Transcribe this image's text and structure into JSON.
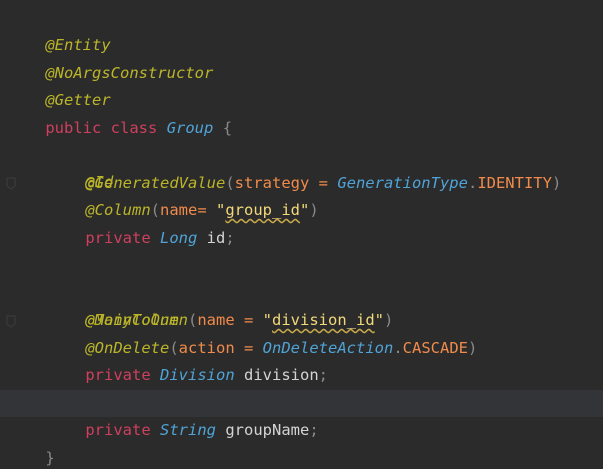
{
  "editor": {
    "language": "java",
    "theme": {
      "background": "#2b2b2b",
      "annotation": "#bbb529",
      "keyword": "#cf3f5e",
      "type": "#4fa3d6",
      "constant": "#f08b4b",
      "string": "#f2d97a",
      "current_line": "#333437"
    },
    "lines": [
      {
        "id": "l1",
        "text": "@Entity"
      },
      {
        "id": "l2",
        "text": "@NoArgsConstructor"
      },
      {
        "id": "l3",
        "text": "@Getter"
      },
      {
        "id": "l4",
        "text": "public class Group {"
      },
      {
        "id": "l5",
        "text": "@Id"
      },
      {
        "id": "l6",
        "text": "@GeneratedValue(strategy = GenerationType.IDENTITY)"
      },
      {
        "id": "l7",
        "text": "@Column(name= \"group_id\")"
      },
      {
        "id": "l8",
        "text": "private Long id;"
      },
      {
        "id": "l9",
        "text": ""
      },
      {
        "id": "l10",
        "text": "@ManyToOne"
      },
      {
        "id": "l11",
        "text": "@JoinColumn(name = \"division_id\")"
      },
      {
        "id": "l12",
        "text": "@OnDelete(action = OnDeleteAction.CASCADE)"
      },
      {
        "id": "l13",
        "text": "private Division division;"
      },
      {
        "id": "l14",
        "text": ""
      },
      {
        "id": "l15",
        "text": "private String groupName;"
      },
      {
        "id": "l16",
        "text": "}"
      }
    ]
  },
  "tokens": {
    "entity": "@Entity",
    "noargs": "@NoArgsConstructor",
    "getter": "@Getter",
    "public": "public",
    "class": "class",
    "group": "Group",
    "lbrace": " {",
    "id_ann": "@Id",
    "generated": "@GeneratedValue",
    "paren_open": "(",
    "strategy": "strategy = ",
    "generation_type": "GenerationType",
    "dot": ".",
    "identity": "IDENTITY",
    "paren_close": ")",
    "column": "@Column",
    "name_eq_a": "name= ",
    "quote": "\"",
    "group_id": "group_id",
    "private": "private",
    "long": "Long",
    "id_field": "id",
    "semicolon": ";",
    "many_to_one": "@ManyToOne",
    "join_column": "@JoinColumn",
    "name_eq_b": "name = ",
    "division_id": "division_id",
    "on_delete": "@OnDelete",
    "action": "action = ",
    "on_delete_action": "OnDeleteAction",
    "cascade": "CASCADE",
    "division_type": "Division",
    "division_field": "division",
    "string_type": "String",
    "group_name": "groupName",
    "rbrace": "}"
  }
}
